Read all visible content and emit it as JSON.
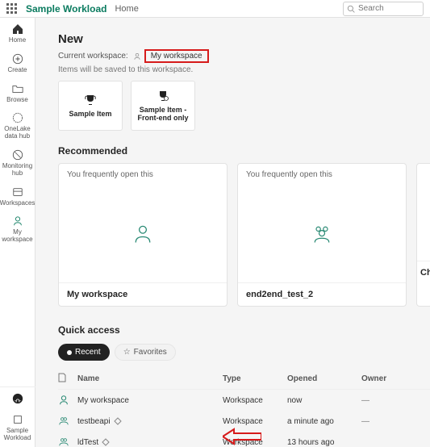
{
  "topbar": {
    "app_title": "Sample Workload",
    "crumb": "Home",
    "search_placeholder": "Search"
  },
  "rail": {
    "home": "Home",
    "create": "Create",
    "browse": "Browse",
    "onelake": "OneLake\ndata hub",
    "monitoring": "Monitoring\nhub",
    "workspaces": "Workspaces",
    "myws": "My\nworkspace",
    "sample": "Sample\nWorkload"
  },
  "new_section": {
    "title": "New",
    "ws_label": "Current workspace:",
    "ws_name": "My workspace",
    "hint": "Items will be saved to this workspace.",
    "tiles": [
      {
        "label": "Sample Item"
      },
      {
        "label": "Sample Item - Front-end only"
      }
    ]
  },
  "recommended": {
    "title": "Recommended",
    "freq_text": "You frequently open this",
    "cards": [
      {
        "name": "My workspace"
      },
      {
        "name": "end2end_test_2"
      },
      {
        "name": "Ch"
      }
    ]
  },
  "quick_access": {
    "title": "Quick access",
    "tab_recent": "Recent",
    "tab_favorites": "Favorites",
    "col_name": "Name",
    "col_type": "Type",
    "col_opened": "Opened",
    "col_owner": "Owner",
    "rows": [
      {
        "name": "My workspace",
        "type": "Workspace",
        "opened": "now",
        "owner": "—",
        "icon": "person",
        "endorsed": false
      },
      {
        "name": "testbeapi",
        "type": "Workspace",
        "opened": "a minute ago",
        "owner": "—",
        "icon": "group",
        "endorsed": true
      },
      {
        "name": "ldTest",
        "type": "Workspace",
        "opened": "13 hours ago",
        "owner": "",
        "icon": "group",
        "endorsed": true
      }
    ]
  }
}
